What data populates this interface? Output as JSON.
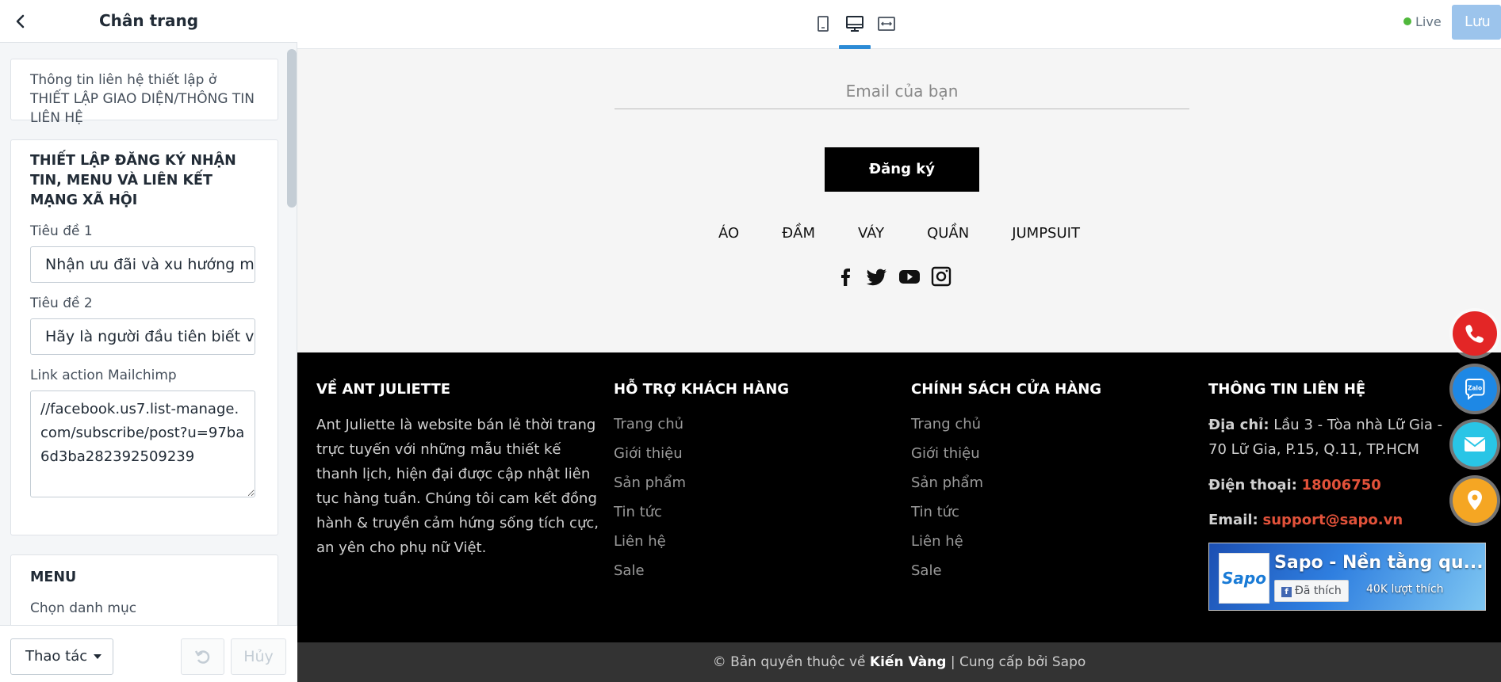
{
  "sidebar": {
    "title": "Chân trang",
    "info_text": "Thông tin liên hệ thiết lập ở THIẾT LẬP GIAO DIỆN/THÔNG TIN LIÊN HỆ",
    "form_heading": "THIẾT LẬP ĐĂNG KÝ NHẬN TIN, MENU VÀ LIÊN KẾT MẠNG XÃ HỘI",
    "title1_label": "Tiêu đề 1",
    "title1_value": "Nhận ưu đãi và xu hướng m",
    "title2_label": "Tiêu đề 2",
    "title2_value": "Hãy là người đầu tiên biết v",
    "mailchimp_label": "Link action Mailchimp",
    "mailchimp_value": "//facebook.us7.list-manage.com/subscribe/post?u=97ba6d3ba282392509239",
    "menu_heading": "MENU",
    "menu_category_label": "Chọn danh mục",
    "actions_label": "Thao tác",
    "cancel_label": "Hủy"
  },
  "topbar": {
    "live_label": "Live",
    "save_label": "Lưu"
  },
  "preview": {
    "email_placeholder": "Email của bạn",
    "subscribe_label": "Đăng ký",
    "menu": [
      "ÁO",
      "ĐẦM",
      "VÁY",
      "QUẦN",
      "JUMPSUIT"
    ],
    "about_title": "VỀ ANT JULIETTE",
    "about_text": "Ant Juliette là website bán lẻ thời trang trực tuyến với những mẫu thiết kế thanh lịch, hiện đại được cập nhật liên tục hàng tuần. Chúng tôi cam kết đồng hành & truyền cảm hứng sống tích cực, an yên cho phụ nữ Việt.",
    "support_title": "HỖ TRỢ KHÁCH HÀNG",
    "support_links": [
      "Trang chủ",
      "Giới thiệu",
      "Sản phẩm",
      "Tin tức",
      "Liên hệ",
      "Sale"
    ],
    "policy_title": "CHÍNH SÁCH CỬA HÀNG",
    "policy_links": [
      "Trang chủ",
      "Giới thiệu",
      "Sản phẩm",
      "Tin tức",
      "Liên hệ",
      "Sale"
    ],
    "contact_title": "THÔNG TIN LIÊN HỆ",
    "address_label": "Địa chỉ:",
    "address_value": " Lầu 3 - Tòa nhà Lữ Gia - 70 Lữ Gia, P.15, Q.11, TP.HCM",
    "phone_label": "Điện thoại:",
    "phone_value": "18006750",
    "email_label": "Email:",
    "email_value": "support@sapo.vn",
    "fb_page_name": "Sapo - Nền tằng qu...",
    "fb_logo_text": "Sapo",
    "fb_like_label": "Đã thích",
    "fb_like_count": "40K lượt thích",
    "copyright_prefix": "© Bản quyền thuộc về ",
    "copyright_brand": "Kiến Vàng",
    "copyright_suffix": " | Cung cấp bởi Sapo"
  },
  "colors": {
    "accent_blue": "#2c8bd6",
    "save_button": "#9cc4ec",
    "live_green": "#50b83c",
    "contact_accent": "#e2523a",
    "phone_button": "#e32626",
    "zalo_button": "#1e88e5",
    "mail_button": "#29c5e6",
    "map_button": "#f5a623"
  },
  "icons": {
    "back": "chevron-left-icon",
    "devices": [
      "mobile-icon",
      "desktop-icon",
      "fullwidth-icon"
    ],
    "social": [
      "facebook-icon",
      "twitter-icon",
      "youtube-icon",
      "instagram-icon"
    ],
    "floating": [
      "phone-icon",
      "zalo-icon",
      "mail-icon",
      "map-pin-icon"
    ]
  }
}
